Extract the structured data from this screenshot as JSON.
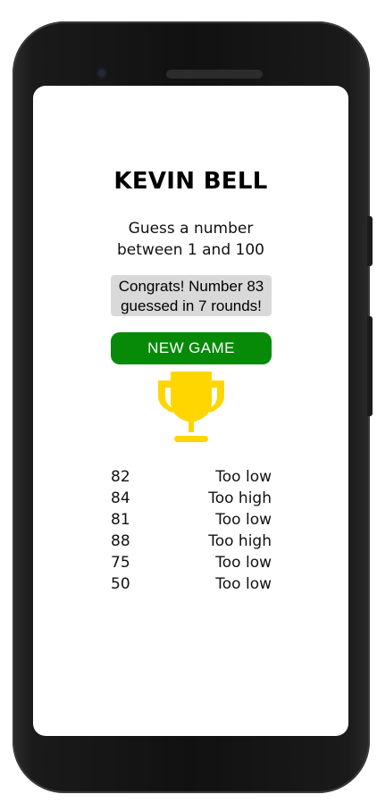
{
  "app": {
    "title": "KEVIN BELL",
    "subtitle_line1": "Guess a number",
    "subtitle_line2": "between 1 and 100"
  },
  "result": {
    "line1": "Congrats! Number 83",
    "line2": "guessed in 7 rounds!"
  },
  "new_game_label": "NEW GAME",
  "icons": {
    "trophy": "trophy-icon"
  },
  "colors": {
    "button": "#078a07",
    "trophy": "#ffd600",
    "result_bg": "#d9d9d9"
  },
  "history": [
    {
      "guess": "82",
      "hint": "Too low"
    },
    {
      "guess": "84",
      "hint": "Too high"
    },
    {
      "guess": "81",
      "hint": "Too low"
    },
    {
      "guess": "88",
      "hint": "Too high"
    },
    {
      "guess": "75",
      "hint": "Too low"
    },
    {
      "guess": "50",
      "hint": "Too low"
    }
  ]
}
